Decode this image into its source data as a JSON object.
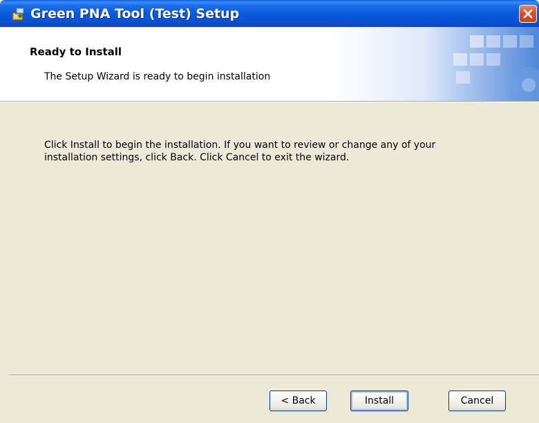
{
  "window": {
    "title": "Green PNA Tool (Test) Setup"
  },
  "header": {
    "title": "Ready to Install",
    "subtitle": "The Setup Wizard is ready to begin installation"
  },
  "body": {
    "text": "Click Install to begin the installation.  If you want to review or change any of your\ninstallation settings, click Back.  Click Cancel to exit the wizard."
  },
  "buttons": {
    "back": "< Back",
    "install": "Install",
    "cancel": "Cancel"
  },
  "icons": {
    "app": "installer-icon",
    "close": "close-icon"
  },
  "colors": {
    "titlebar": "#0a58dc",
    "close": "#d8512c",
    "dialog_bg": "#ece9d8"
  }
}
